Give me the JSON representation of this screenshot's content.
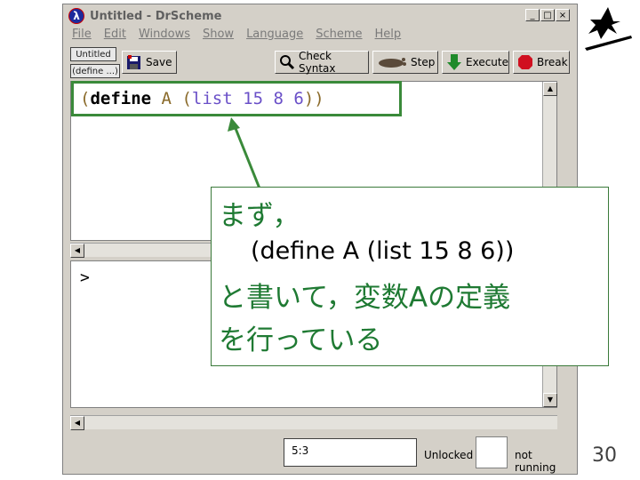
{
  "window": {
    "title": "Untitled - DrScheme",
    "app_icon": "lambda-icon",
    "app_icon_glyph": "λ",
    "controls": {
      "minimize": "_",
      "maximize": "□",
      "close": "×"
    }
  },
  "menu": [
    "File",
    "Edit",
    "Windows",
    "Show",
    "Language",
    "Scheme",
    "Help"
  ],
  "tabs": {
    "file_tab": "Untitled",
    "define_tab": "(define ...)"
  },
  "toolbar": {
    "save": "Save",
    "check_syntax": "Check Syntax",
    "step": "Step",
    "execute": "Execute",
    "break": "Break"
  },
  "definitions": {
    "tokens": [
      {
        "text": "(",
        "kind": "paren"
      },
      {
        "text": "define",
        "kind": "kw"
      },
      {
        "text": " ",
        "kind": "sp"
      },
      {
        "text": "A",
        "kind": "var"
      },
      {
        "text": " ",
        "kind": "sp"
      },
      {
        "text": "(",
        "kind": "paren"
      },
      {
        "text": "list",
        "kind": "num"
      },
      {
        "text": " ",
        "kind": "sp"
      },
      {
        "text": "15",
        "kind": "num"
      },
      {
        "text": " ",
        "kind": "sp"
      },
      {
        "text": "8",
        "kind": "num"
      },
      {
        "text": " ",
        "kind": "sp"
      },
      {
        "text": "6",
        "kind": "num"
      },
      {
        "text": "))",
        "kind": "paren"
      }
    ]
  },
  "interactions": {
    "prompt": ">"
  },
  "status": {
    "line_col": "5:3",
    "lock": "Unlocked",
    "running": "not running"
  },
  "callout": {
    "line1": "まず，",
    "line2": "(define A (list 15 8 6))",
    "line3": "と書いて，変数Aの定義",
    "line4": "を行っている"
  },
  "slide_number": "30",
  "colors": {
    "accent_green": "#1f7a33",
    "highlight_border": "#3a8a3a",
    "window_bg": "#d4d0c8"
  }
}
